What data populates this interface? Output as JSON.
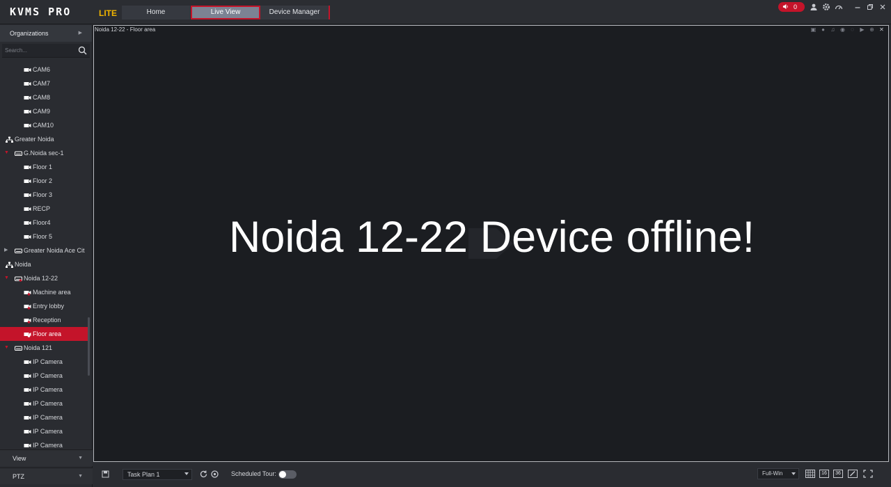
{
  "app": {
    "logo": "KVMS PRO",
    "logo_suffix": "LITE",
    "tabs": [
      {
        "label": "Home"
      },
      {
        "label": "Live View"
      },
      {
        "label": "Device Manager"
      }
    ],
    "alarm_count": "0",
    "accent_color": "#c4142a"
  },
  "sidebar": {
    "header": "Organizations",
    "search_placeholder": "Search...",
    "tree": [
      {
        "label": "CAM6",
        "type": "camera"
      },
      {
        "label": "CAM7",
        "type": "camera"
      },
      {
        "label": "CAM8",
        "type": "camera"
      },
      {
        "label": "CAM9",
        "type": "camera"
      },
      {
        "label": "CAM10",
        "type": "camera"
      },
      {
        "label": "Greater Noida",
        "type": "org"
      },
      {
        "label": "G.Noida sec-1",
        "type": "nvr"
      },
      {
        "label": "Floor 1",
        "type": "camera"
      },
      {
        "label": "Floor 2",
        "type": "camera"
      },
      {
        "label": "Floor 3",
        "type": "camera"
      },
      {
        "label": "RECP",
        "type": "camera"
      },
      {
        "label": "Floor4",
        "type": "camera"
      },
      {
        "label": "Floor 5",
        "type": "camera"
      },
      {
        "label": "Greater Noida Ace Cit",
        "type": "nvr"
      },
      {
        "label": "Noida",
        "type": "org"
      },
      {
        "label": "Noida 12-22",
        "type": "nvr"
      },
      {
        "label": "Machine area",
        "type": "camera"
      },
      {
        "label": "Entry lobby",
        "type": "camera"
      },
      {
        "label": "Reception",
        "type": "camera"
      },
      {
        "label": "Floor area",
        "type": "camera"
      },
      {
        "label": "Noida 121",
        "type": "nvr"
      },
      {
        "label": "IP Camera",
        "type": "camera"
      },
      {
        "label": "IP Camera",
        "type": "camera"
      },
      {
        "label": "IP Camera",
        "type": "camera"
      },
      {
        "label": "IP Camera",
        "type": "camera"
      },
      {
        "label": "IP Camera",
        "type": "camera"
      },
      {
        "label": "IP Camera",
        "type": "camera"
      },
      {
        "label": "IP Camera",
        "type": "camera"
      }
    ],
    "footer_view": "View",
    "footer_ptz": "PTZ"
  },
  "video": {
    "title": "Noida 12-22 - Floor area",
    "message": "Noida 12-22 Device offline!"
  },
  "bottom": {
    "task_plan": "Task Plan 1",
    "scheduled_tour_label": "Scheduled Tour:",
    "window_mode": "Full-Win",
    "layout_16": "16",
    "layout_36": "36"
  }
}
